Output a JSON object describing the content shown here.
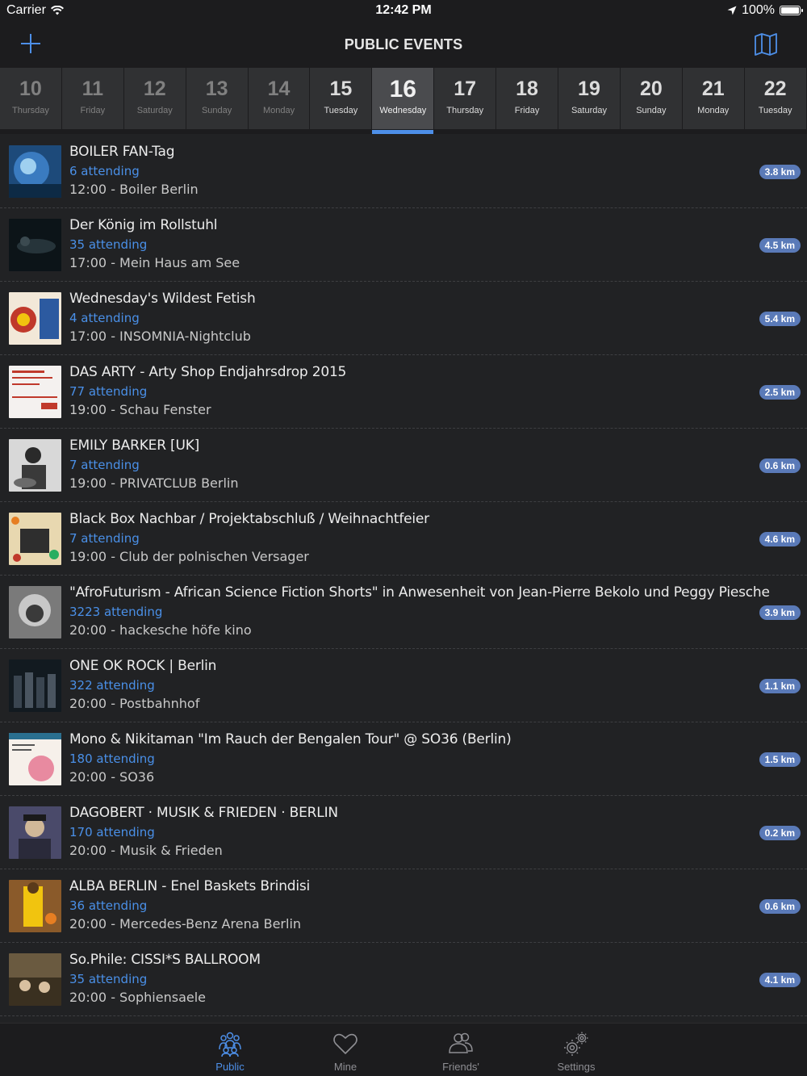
{
  "status_bar": {
    "carrier": "Carrier",
    "time": "12:42 PM",
    "battery": "100%"
  },
  "nav": {
    "title": "PUBLIC EVENTS",
    "add_icon": "plus-icon",
    "map_icon": "map-icon"
  },
  "dates": [
    {
      "num": "10",
      "day": "Thursday",
      "past": true
    },
    {
      "num": "11",
      "day": "Friday",
      "past": true
    },
    {
      "num": "12",
      "day": "Saturday",
      "past": true
    },
    {
      "num": "13",
      "day": "Sunday",
      "past": true
    },
    {
      "num": "14",
      "day": "Monday",
      "past": true
    },
    {
      "num": "15",
      "day": "Tuesday",
      "past": false
    },
    {
      "num": "16",
      "day": "Wednesday",
      "past": false,
      "selected": true
    },
    {
      "num": "17",
      "day": "Thursday",
      "past": false
    },
    {
      "num": "18",
      "day": "Friday",
      "past": false
    },
    {
      "num": "19",
      "day": "Saturday",
      "past": false
    },
    {
      "num": "20",
      "day": "Sunday",
      "past": false
    },
    {
      "num": "21",
      "day": "Monday",
      "past": false
    },
    {
      "num": "22",
      "day": "Tuesday",
      "past": false
    }
  ],
  "events": [
    {
      "title": "BOILER FAN-Tag",
      "attending": "6 attending",
      "when": "12:00 - Boiler Berlin",
      "distance": "3.8 km"
    },
    {
      "title": "Der König im Rollstuhl",
      "attending": "35 attending",
      "when": "17:00 - Mein Haus am See",
      "distance": "4.5 km"
    },
    {
      "title": "Wednesday's Wildest Fetish",
      "attending": "4 attending",
      "when": "17:00 - INSOMNIA-Nightclub",
      "distance": "5.4 km"
    },
    {
      "title": "DAS ARTY - Arty Shop Endjahrsdrop 2015",
      "attending": "77 attending",
      "when": "19:00 - Schau Fenster",
      "distance": "2.5 km"
    },
    {
      "title": "EMILY BARKER [UK]",
      "attending": "7 attending",
      "when": "19:00 - PRIVATCLUB Berlin",
      "distance": "0.6 km"
    },
    {
      "title": "Black Box Nachbar / Projektabschluß / Weihnachtfeier",
      "attending": "7 attending",
      "when": "19:00 - Club der polnischen Versager",
      "distance": "4.6 km"
    },
    {
      "title": "\"AfroFuturism - African Science Fiction Shorts\" in Anwesenheit von Jean-Pierre Bekolo und Peggy Piesche",
      "attending": "3223 attending",
      "when": "20:00 - hackesche höfe kino",
      "distance": "3.9 km"
    },
    {
      "title": "ONE OK ROCK | Berlin",
      "attending": "322 attending",
      "when": "20:00 - Postbahnhof",
      "distance": "1.1 km"
    },
    {
      "title": "Mono & Nikitaman \"Im Rauch der Bengalen Tour\" @ SO36 (Berlin)",
      "attending": "180 attending",
      "when": "20:00 - SO36",
      "distance": "1.5 km"
    },
    {
      "title": "DAGOBERT · MUSIK & FRIEDEN · BERLIN",
      "attending": "170 attending",
      "when": "20:00 - Musik & Frieden",
      "distance": "0.2 km"
    },
    {
      "title": "ALBA BERLIN - Enel Baskets Brindisi",
      "attending": "36 attending",
      "when": "20:00 - Mercedes-Benz Arena Berlin",
      "distance": "0.6 km"
    },
    {
      "title": "So.Phile: CISSI*S BALLROOM",
      "attending": "35 attending",
      "when": "20:00 - Sophiensaele",
      "distance": "4.1 km"
    }
  ],
  "tabs": [
    {
      "label": "Public",
      "icon": "people-group-icon",
      "active": true
    },
    {
      "label": "Mine",
      "icon": "heart-icon",
      "active": false
    },
    {
      "label": "Friends'",
      "icon": "friends-icon",
      "active": false
    },
    {
      "label": "Settings",
      "icon": "gears-icon",
      "active": false
    }
  ]
}
